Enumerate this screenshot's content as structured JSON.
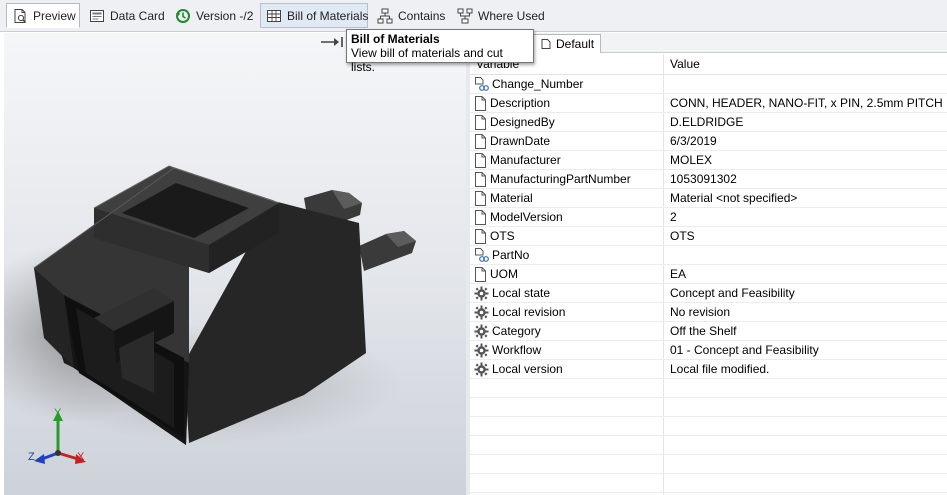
{
  "tabs": [
    {
      "label": "Preview",
      "icon": "preview-icon"
    },
    {
      "label": "Data Card",
      "icon": "data-card-icon"
    },
    {
      "label": "Version -/2",
      "icon": "version-icon"
    },
    {
      "label": "Bill of Materials",
      "icon": "bill-of-materials-icon"
    },
    {
      "label": "Contains",
      "icon": "contains-icon"
    },
    {
      "label": "Where Used",
      "icon": "where-used-icon"
    }
  ],
  "tooltip": {
    "title": "Bill of Materials",
    "description": "View bill of materials and cut lists."
  },
  "config_tab": {
    "label": "Default"
  },
  "table": {
    "headers": {
      "variable": "Variable",
      "value": "Value"
    },
    "rows": [
      {
        "name": "Change_Number",
        "value": "",
        "icon": "linked-variable-icon"
      },
      {
        "name": "Description",
        "value": "CONN, HEADER, NANO-FIT, x PIN, 2.5mm PITCH",
        "icon": "document-icon"
      },
      {
        "name": "DesignedBy",
        "value": "D.ELDRIDGE",
        "icon": "document-icon"
      },
      {
        "name": "DrawnDate",
        "value": "6/3/2019",
        "icon": "document-icon"
      },
      {
        "name": "Manufacturer",
        "value": "MOLEX",
        "icon": "document-icon"
      },
      {
        "name": "ManufacturingPartNumber",
        "value": "1053091302",
        "icon": "document-icon"
      },
      {
        "name": "Material",
        "value": "Material <not specified>",
        "icon": "document-icon"
      },
      {
        "name": "ModelVersion",
        "value": "2",
        "icon": "document-icon"
      },
      {
        "name": "OTS",
        "value": "OTS",
        "icon": "document-icon"
      },
      {
        "name": "PartNo",
        "value": "",
        "icon": "linked-variable-icon"
      },
      {
        "name": "UOM",
        "value": "EA",
        "icon": "document-icon"
      },
      {
        "name": "Local state",
        "value": "Concept and Feasibility",
        "icon": "gear-icon"
      },
      {
        "name": "Local revision",
        "value": "No revision",
        "icon": "gear-icon"
      },
      {
        "name": "Category",
        "value": "Off the Shelf",
        "icon": "gear-icon"
      },
      {
        "name": "Workflow",
        "value": "01 - Concept and Feasibility",
        "icon": "gear-icon"
      },
      {
        "name": "Local version",
        "value": "Local file modified.",
        "icon": "gear-icon"
      }
    ]
  },
  "triad": {
    "x": "X",
    "y": "Y",
    "z": "Z"
  },
  "colors": {
    "accent_blue": "#2f6fbf",
    "version_green": "#1e8a2e"
  }
}
